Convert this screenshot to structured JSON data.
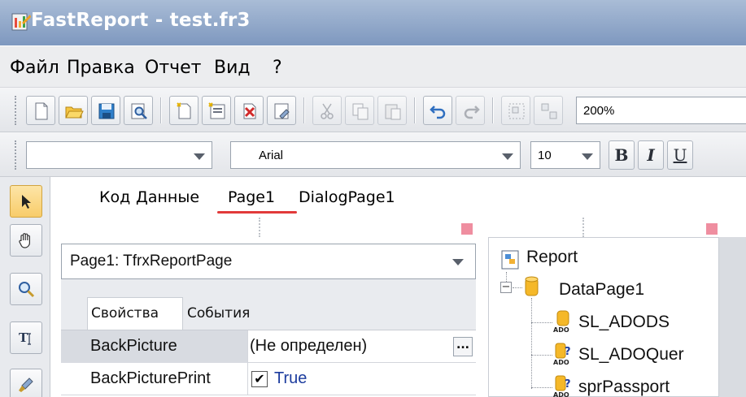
{
  "window": {
    "title": "FastReport - test.fr3"
  },
  "menu": {
    "items": [
      "Файл",
      "Правка",
      "Отчет",
      "Вид",
      "?"
    ]
  },
  "toolbar": {
    "zoom": "200%",
    "style_combo": "",
    "font_name": "Arial",
    "font_size": "10",
    "bold_label": "B",
    "italic_label": "I",
    "underline_label": "U"
  },
  "tabs": [
    "Код",
    "Данные",
    "Page1",
    "DialogPage1"
  ],
  "active_tab": "Page1",
  "inspector": {
    "object": "Page1: TfrxReportPage",
    "tabs": [
      "Свойства",
      "События"
    ],
    "properties": [
      {
        "name": "BackPicture",
        "value": "(Не определен)"
      },
      {
        "name": "BackPicturePrint",
        "value": "True",
        "checked": true
      }
    ],
    "ellipsis": "..."
  },
  "tree": {
    "root": "Report",
    "datapage": "DataPage1",
    "items": [
      "SL_ADODS",
      "SL_ADOQuer",
      "sprPassport"
    ]
  },
  "colors": {
    "title_bar": "#8aa2c6",
    "tab_underline": "#e23a3a",
    "active_tool": "#f8cc6a"
  }
}
